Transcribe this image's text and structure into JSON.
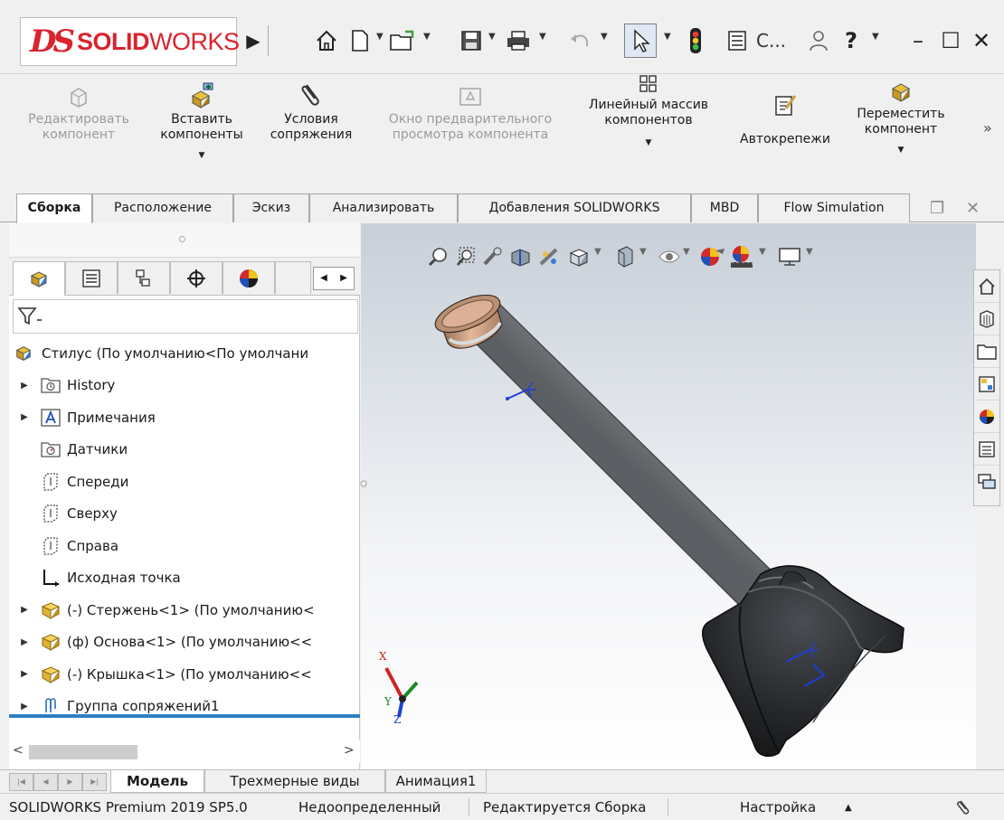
{
  "app": {
    "logo_ds": "DS",
    "logo_solid": "SOLID",
    "logo_works": "WORKS",
    "document_title_short": "С...",
    "accent_red": "#d9232d",
    "selection_blue": "#2e7fc3"
  },
  "quick_access": {
    "icons": [
      "home-icon",
      "new-document-icon",
      "open-icon",
      "save-icon",
      "print-icon",
      "undo-icon",
      "select-pointer-icon",
      "rebuild-icon",
      "file-properties-icon",
      "user-icon",
      "help-icon"
    ],
    "window_minimize": "–",
    "window_maximize": "☐",
    "window_close": "✕",
    "help": "?"
  },
  "ribbon": {
    "edit_component": "Редактировать\nкомпонент",
    "insert_components": "Вставить\nкомпоненты",
    "mate": "Условия\nсопряжения",
    "component_preview": "Окно предварительного\nпросмотра компонента",
    "linear_pattern": "Линейный массив\nкомпонентов",
    "smart_fasteners": "Автокрепежи",
    "move_component": "Переместить\nкомпонент",
    "more": "»"
  },
  "tabs": [
    {
      "label": "Сборка",
      "active": true
    },
    {
      "label": "Расположение",
      "active": false
    },
    {
      "label": "Эскиз",
      "active": false
    },
    {
      "label": "Анализировать",
      "active": false
    },
    {
      "label": "Добавления SOLIDWORKS",
      "active": false
    },
    {
      "label": "MBD",
      "active": false
    },
    {
      "label": "Flow Simulation",
      "active": false
    }
  ],
  "feature_tree": {
    "root": "Стилус  (По умолчанию<По умолчани",
    "items": [
      {
        "label": "History",
        "expandable": true,
        "icon": "history-folder-icon"
      },
      {
        "label": "Примечания",
        "expandable": true,
        "icon": "annotations-icon"
      },
      {
        "label": "Датчики",
        "expandable": false,
        "icon": "sensors-icon"
      },
      {
        "label": "Спереди",
        "expandable": false,
        "icon": "plane-icon"
      },
      {
        "label": "Сверху",
        "expandable": false,
        "icon": "plane-icon"
      },
      {
        "label": "Справа",
        "expandable": false,
        "icon": "plane-icon"
      },
      {
        "label": "Исходная точка",
        "expandable": false,
        "icon": "origin-icon"
      },
      {
        "label": "(-) Стержень<1> (По умолчанию<",
        "expandable": true,
        "icon": "part-icon"
      },
      {
        "label": "(ф) Основа<1> (По умолчанию<<",
        "expandable": true,
        "icon": "part-icon"
      },
      {
        "label": "(-) Крышка<1> (По умолчанию<<",
        "expandable": true,
        "icon": "part-icon"
      },
      {
        "label": "Группа сопряжений1",
        "expandable": true,
        "icon": "mates-icon"
      }
    ]
  },
  "triad": {
    "x": "X",
    "y": "Y",
    "z": "Z"
  },
  "bottom_tabs": [
    {
      "label": "Модель",
      "active": true
    },
    {
      "label": "Трехмерные виды",
      "active": false
    },
    {
      "label": "Анимация1",
      "active": false
    }
  ],
  "status_bar": {
    "product": "SOLIDWORKS Premium 2019 SP5.0",
    "definition": "Недоопределенный",
    "editing": "Редактируется Сборка",
    "customize": "Настройка",
    "customize_arrow": "▲"
  }
}
